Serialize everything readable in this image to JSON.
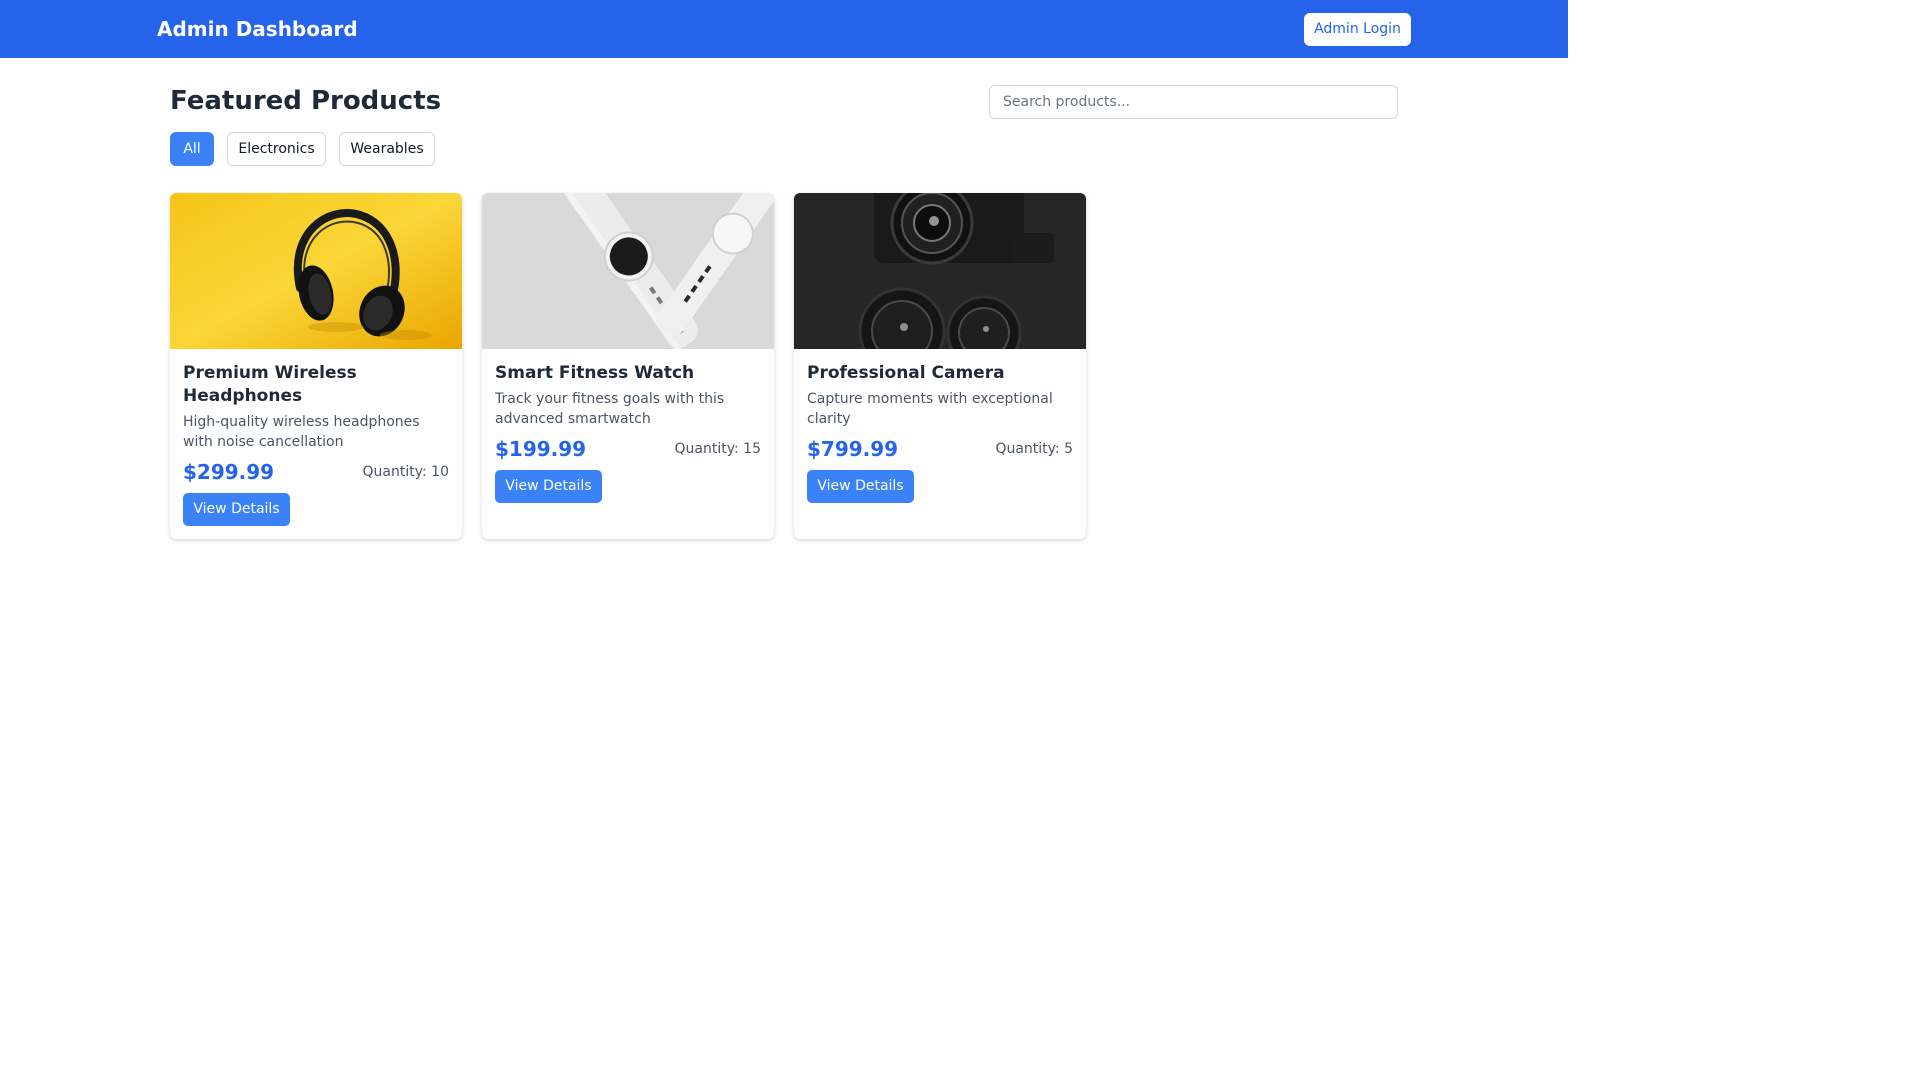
{
  "header": {
    "brand": "Admin Dashboard",
    "login_label": "Admin Login",
    "background_color": "#2563eb"
  },
  "main": {
    "title": "Featured Products",
    "search_placeholder": "Search products...",
    "filters": [
      {
        "label": "All",
        "active": true
      },
      {
        "label": "Electronics",
        "active": false
      },
      {
        "label": "Wearables",
        "active": false
      }
    ]
  },
  "products": [
    {
      "name": "Premium Wireless Headphones",
      "description": "High-quality wireless headphones with noise cancellation",
      "price": "$299.99",
      "quantity": "Quantity: 10",
      "button_label": "View Details",
      "image": "headphones-photo"
    },
    {
      "name": "Smart Fitness Watch",
      "description": "Track your fitness goals with this advanced smartwatch",
      "price": "$199.99",
      "quantity": "Quantity: 15",
      "button_label": "View Details",
      "image": "smartwatch-photo"
    },
    {
      "name": "Professional Camera",
      "description": "Capture moments with exceptional clarity",
      "price": "$799.99",
      "quantity": "Quantity: 5",
      "button_label": "View Details",
      "image": "camera-photo"
    }
  ],
  "colors": {
    "accent": "#3b82f6",
    "price": "#2563eb"
  }
}
